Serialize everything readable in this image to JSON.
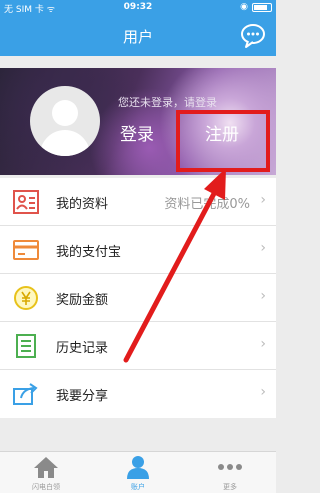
{
  "status_bar": {
    "carrier": "无 SIM 卡 ᯤ",
    "time": "09:32"
  },
  "nav": {
    "title": "用户",
    "chat_icon": "chat-bubble-icon"
  },
  "banner": {
    "hint": "您还未登录，请登录",
    "login_label": "登录",
    "register_label": "注册"
  },
  "menu": {
    "items": [
      {
        "label": "我的资料",
        "value": "资料已完成0%",
        "icon": "profile-card-icon"
      },
      {
        "label": "我的支付宝",
        "value": "",
        "icon": "card-icon"
      },
      {
        "label": "奖励金额",
        "value": "",
        "icon": "yuan-coin-icon"
      },
      {
        "label": "历史记录",
        "value": "",
        "icon": "document-icon"
      },
      {
        "label": "我要分享",
        "value": "",
        "icon": "share-icon"
      }
    ],
    "chevron": "›"
  },
  "tabbar": {
    "tabs": [
      {
        "label": "闪电白领",
        "icon": "home-icon"
      },
      {
        "label": "账户",
        "icon": "person-icon"
      },
      {
        "label": "更多",
        "icon": "more-dots-icon"
      }
    ],
    "active_index": 1
  },
  "colors": {
    "accent": "#3aa0e6",
    "highlight": "#e21c1c"
  }
}
